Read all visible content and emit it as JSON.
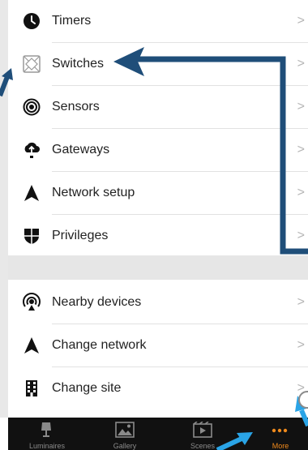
{
  "menu": {
    "items": [
      {
        "label": "Timers",
        "icon": "clock-icon"
      },
      {
        "label": "Switches",
        "icon": "switch-icon"
      },
      {
        "label": "Sensors",
        "icon": "sensor-icon"
      },
      {
        "label": "Gateways",
        "icon": "gateway-icon"
      },
      {
        "label": "Network setup",
        "icon": "network-icon"
      },
      {
        "label": "Privileges",
        "icon": "shield-icon"
      }
    ],
    "items2": [
      {
        "label": "Nearby devices",
        "icon": "nearby-devices-icon"
      },
      {
        "label": "Change network",
        "icon": "network-icon"
      },
      {
        "label": "Change site",
        "icon": "building-icon"
      }
    ],
    "chevron": ">"
  },
  "tabbar": {
    "tabs": [
      {
        "label": "Luminaires",
        "icon": "lamp-icon"
      },
      {
        "label": "Gallery",
        "icon": "gallery-icon"
      },
      {
        "label": "Scenes",
        "icon": "scenes-icon"
      },
      {
        "label": "More",
        "icon": "more-icon",
        "active": true
      }
    ],
    "active_color": "#f08a1c"
  },
  "colors": {
    "annotation_dark": "#1f4e79",
    "annotation_light": "#2aa4e6"
  }
}
